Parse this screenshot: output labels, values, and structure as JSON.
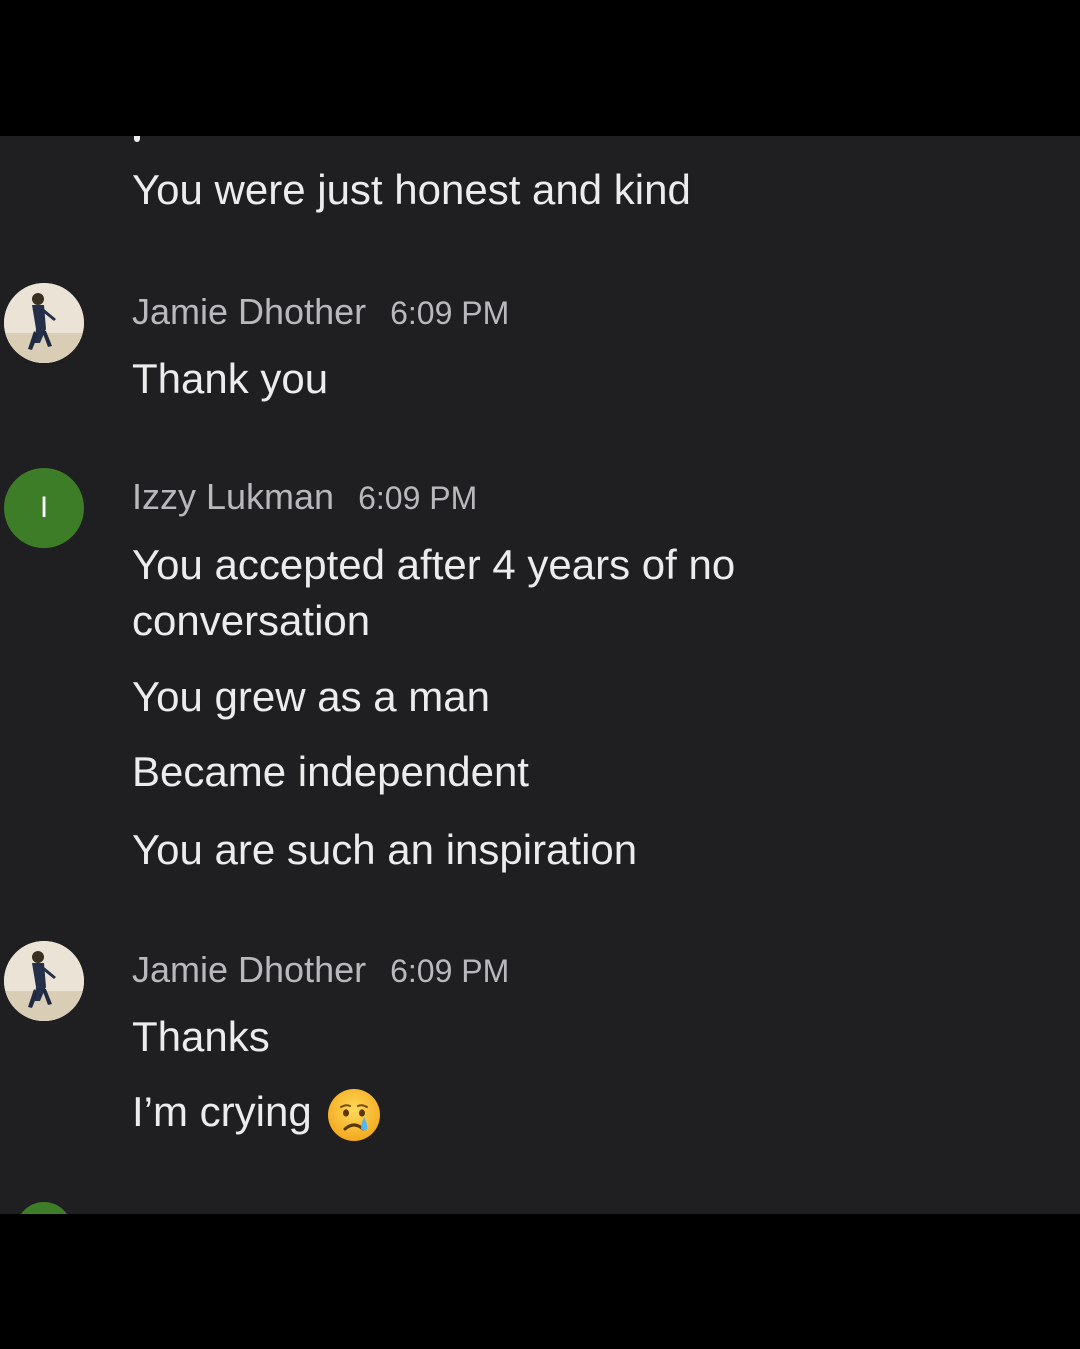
{
  "messages": {
    "prev_tail": "You were just honest and kind",
    "group1": {
      "sender": "Jamie Dhother",
      "time": "6:09 PM",
      "lines": [
        "Thank you"
      ]
    },
    "group2": {
      "sender": "Izzy Lukman",
      "time": "6:09 PM",
      "avatar_letter": "I",
      "lines": [
        "You accepted after 4 years of no conversation",
        "You grew as a man",
        "Became independent",
        "You are such an inspiration"
      ]
    },
    "group3": {
      "sender": "Jamie Dhother",
      "time": "6:09 PM",
      "lines": [
        "Thanks",
        "I’m crying"
      ]
    }
  },
  "icons": {
    "crying_emoji": "crying-face-icon"
  },
  "colors": {
    "chat_background": "#1f1f22",
    "frame": "#000000",
    "avatar_green": "#3e7d27",
    "message_text": "#ececec",
    "meta_text": "#b9b9bd"
  }
}
